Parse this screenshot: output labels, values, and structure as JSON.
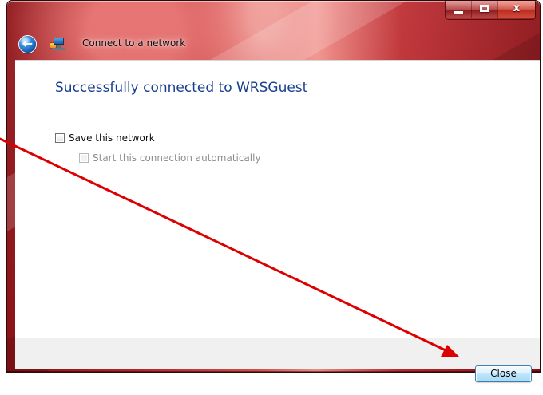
{
  "window": {
    "title": "Connect to a network",
    "controls": {
      "close_label": "x"
    }
  },
  "content": {
    "heading": "Successfully connected to WRSGuest",
    "save_network_label": "Save this network",
    "save_network_checked": false,
    "start_automatically_label": "Start this connection automatically",
    "start_automatically_enabled": false,
    "start_automatically_checked": false
  },
  "footer": {
    "close_button_label": "Close"
  },
  "icons": {
    "back": "back-arrow-icon",
    "network": "network-connection-icon",
    "minimize": "minimize-icon",
    "maximize": "maximize-icon",
    "window_close": "close-icon"
  },
  "colors": {
    "window_frame": "#b3262a",
    "heading_text": "#183f8e",
    "annotation_arrow": "#dd0000",
    "close_button_border": "#3c7fb1"
  }
}
